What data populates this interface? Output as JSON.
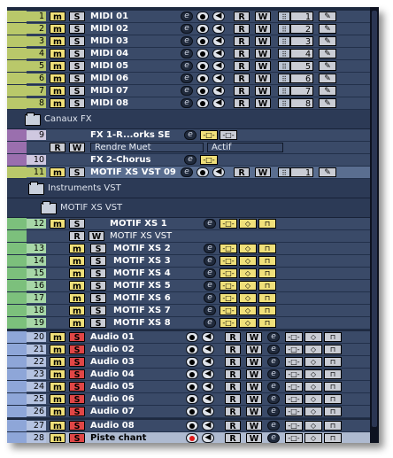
{
  "colors": {
    "midi_strip": "#b9c86a",
    "instrument_strip": "#7cc07c",
    "audio_strip": "#8ea6d8",
    "fx_strip": "#9a6fae",
    "mute": "#f0e07a",
    "solo": "#c9ccd4",
    "solo_audio": "#e04646"
  },
  "labels": {
    "m": "m",
    "s": "S",
    "r": "R",
    "w": "W",
    "e": "e",
    "pen": "✎",
    "grid": "⠿"
  },
  "midi_tracks": [
    {
      "num": "1",
      "name": "MIDI 01",
      "chan": "1"
    },
    {
      "num": "2",
      "name": "MIDI 02",
      "chan": "2"
    },
    {
      "num": "3",
      "name": "MIDI 03",
      "chan": "3"
    },
    {
      "num": "4",
      "name": "MIDI 04",
      "chan": "4"
    },
    {
      "num": "5",
      "name": "MIDI 05",
      "chan": "5"
    },
    {
      "num": "6",
      "name": "MIDI 06",
      "chan": "6"
    },
    {
      "num": "7",
      "name": "MIDI 07",
      "chan": "7"
    },
    {
      "num": "8",
      "name": "MIDI 08",
      "chan": "8"
    }
  ],
  "folders": {
    "fx": "Canaux FX",
    "instruments": "Instruments VST",
    "motif": "MOTIF XS VST"
  },
  "fx_tracks": [
    {
      "num": "9",
      "name": "FX 1-R...orks SE"
    },
    {
      "num": "10",
      "name": "FX 2-Chorus"
    }
  ],
  "fx_row": {
    "field1": "Rendre Muet",
    "field2": "Actif"
  },
  "motif_vst_track": {
    "num": "11",
    "name": "MOTIF XS VST 09",
    "chan": "1"
  },
  "motif_header": {
    "num": "12",
    "name": "MOTIF XS 1",
    "sub": "MOTIF XS VST"
  },
  "instrument_tracks": [
    {
      "num": "13",
      "name": "MOTIF XS 2"
    },
    {
      "num": "14",
      "name": "MOTIF XS 3"
    },
    {
      "num": "15",
      "name": "MOTIF XS 4"
    },
    {
      "num": "16",
      "name": "MOTIF XS 5"
    },
    {
      "num": "17",
      "name": "MOTIF XS 6"
    },
    {
      "num": "18",
      "name": "MOTIF XS 7"
    },
    {
      "num": "19",
      "name": "MOTIF XS 8"
    }
  ],
  "audio_tracks": [
    {
      "num": "20",
      "name": "Audio 01"
    },
    {
      "num": "21",
      "name": "Audio 02"
    },
    {
      "num": "22",
      "name": "Audio 03"
    },
    {
      "num": "23",
      "name": "Audio 04"
    },
    {
      "num": "24",
      "name": "Audio 05"
    },
    {
      "num": "25",
      "name": "Audio 06"
    },
    {
      "num": "26",
      "name": "Audio 07"
    },
    {
      "num": "27",
      "name": "Audio 08"
    },
    {
      "num": "28",
      "name": "Piste chant"
    }
  ]
}
